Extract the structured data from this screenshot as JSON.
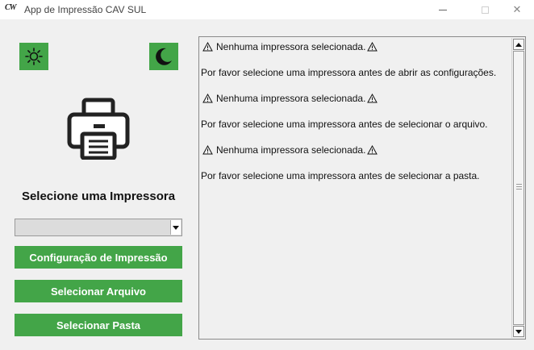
{
  "window": {
    "logo_text": "CW",
    "title": "App de Impressão CAV SUL",
    "close_glyph": "✕"
  },
  "theme": {
    "light_icon": "sun-icon",
    "dark_icon": "moon-icon",
    "accent_color": "#43a548"
  },
  "main": {
    "printer_icon": "printer-icon",
    "section_title": "Selecione uma Impressora",
    "printer_select": {
      "selected_value": ""
    },
    "buttons": {
      "config_label": "Configuração de Impressão",
      "file_label": "Selecionar Arquivo",
      "folder_label": "Selecionar Pasta"
    }
  },
  "log": {
    "entries": [
      {
        "type": "warning",
        "text": "Nenhuma impressora selecionada."
      },
      {
        "type": "message",
        "text": "Por favor selecione uma impressora antes de abrir as configurações."
      },
      {
        "type": "warning",
        "text": "Nenhuma impressora selecionada."
      },
      {
        "type": "message",
        "text": "Por favor selecione uma impressora antes de selecionar o arquivo."
      },
      {
        "type": "warning",
        "text": "Nenhuma impressora selecionada."
      },
      {
        "type": "message",
        "text": "Por favor selecione uma impressora antes de selecionar a pasta."
      }
    ]
  }
}
